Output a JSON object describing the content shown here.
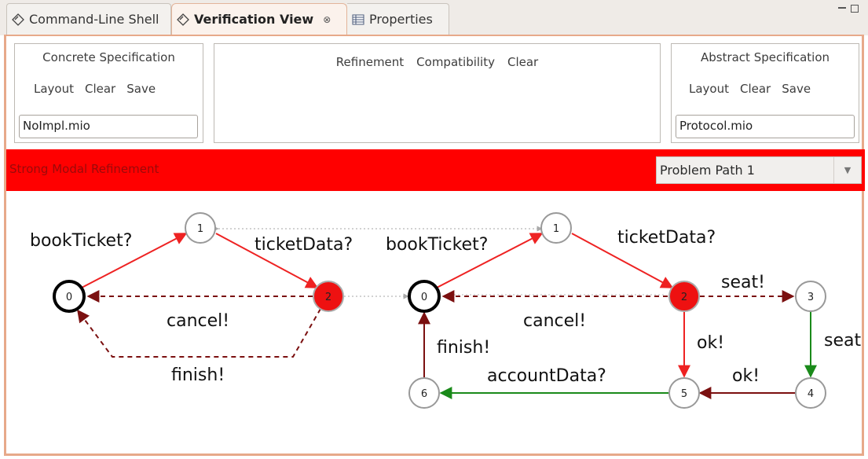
{
  "tabs": [
    {
      "label": "Command-Line Shell",
      "icon": "shell-diamond-icon"
    },
    {
      "label": "Verification View",
      "icon": "verification-diamond-icon",
      "active": true
    },
    {
      "label": "Properties",
      "icon": "properties-table-icon"
    }
  ],
  "concrete": {
    "title": "Concrete Specification",
    "layout": "Layout",
    "clear": "Clear",
    "save": "Save",
    "file": "NoImpl.mio"
  },
  "middle": {
    "refinement": "Refinement",
    "compatibility": "Compatibility",
    "clear": "Clear"
  },
  "abstract": {
    "title": "Abstract Specification",
    "layout": "Layout",
    "clear": "Clear",
    "save": "Save",
    "file": "Protocol.mio"
  },
  "result": {
    "label": "Strong Modal Refinement",
    "selected_path": "Problem Path 1",
    "color": "#ff0000"
  },
  "left_graph": {
    "nodes": [
      "0",
      "1",
      "2"
    ],
    "labels": {
      "bookTicket": "bookTicket?",
      "ticketData": "ticketData?",
      "cancel": "cancel!",
      "finish": "finish!"
    }
  },
  "right_graph": {
    "nodes": [
      "0",
      "1",
      "2",
      "3",
      "4",
      "5",
      "6"
    ],
    "labels": {
      "bookTicket": "bookTicket?",
      "ticketData": "ticketData?",
      "cancel": "cancel!",
      "seat1": "seat!",
      "seat2": "seat",
      "ok1": "ok!",
      "ok2": "ok!",
      "accountData": "accountData?",
      "finish": "finish!"
    }
  },
  "colors": {
    "must": "#ee2222",
    "may": "#7b1010",
    "green": "#1a8a1a",
    "highlight": "#ff0000"
  }
}
